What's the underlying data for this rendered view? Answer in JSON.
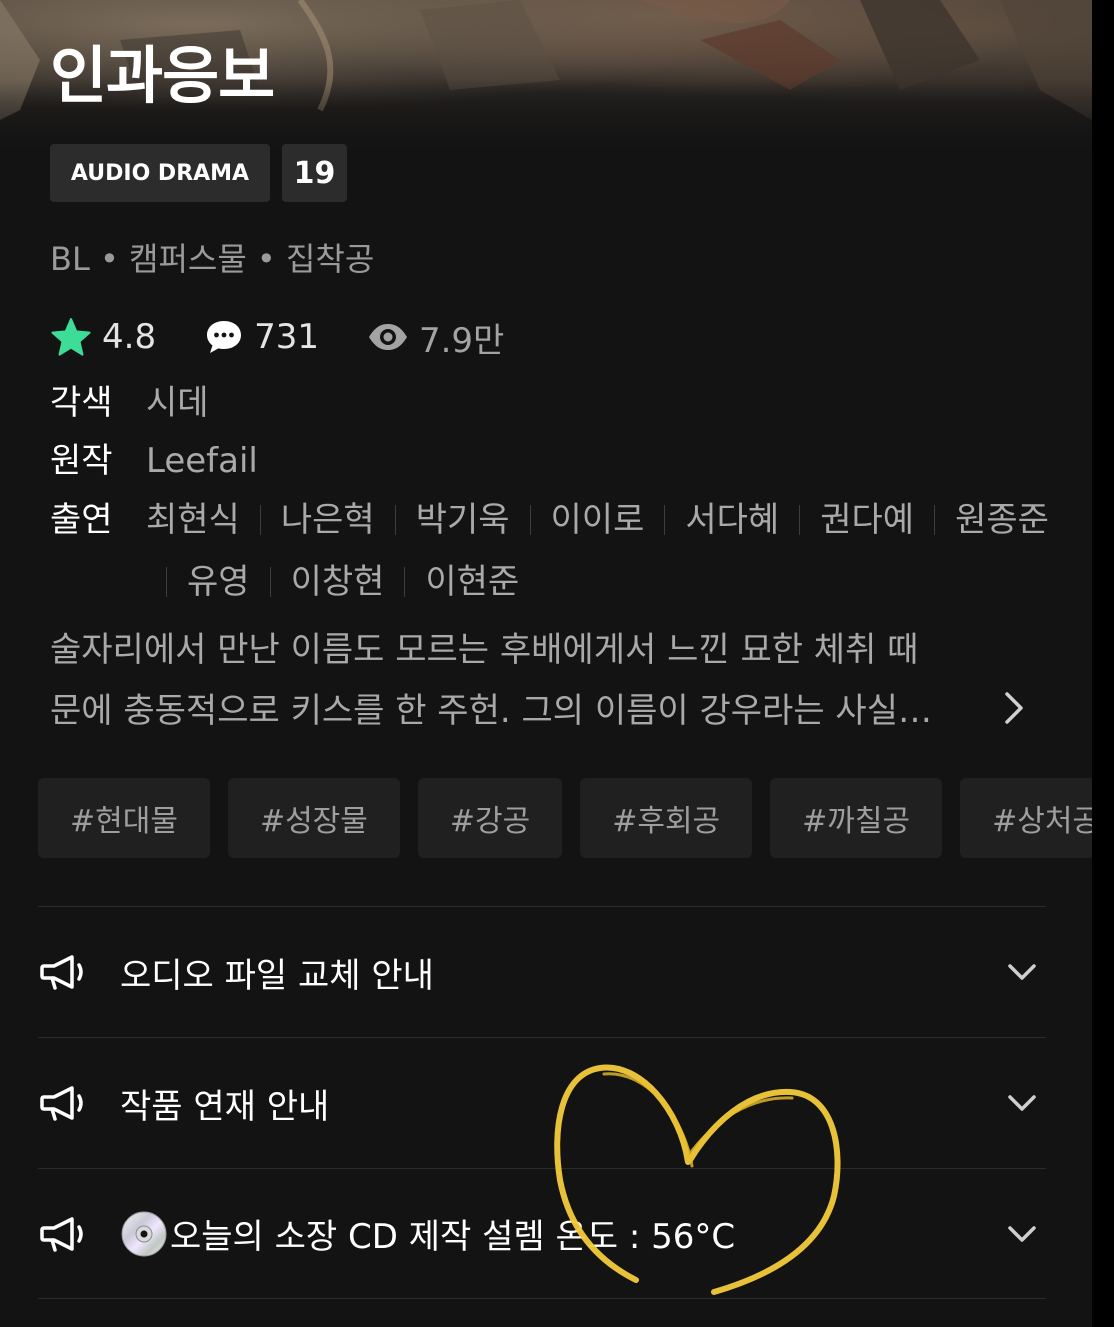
{
  "header": {
    "title": "인과응보",
    "badges": [
      "AUDIO DRAMA",
      "19"
    ]
  },
  "genres": "BL • 캠퍼스물 • 집착공",
  "stats": {
    "rating": "4.8",
    "comments": "731",
    "views": "7.9만"
  },
  "credits": {
    "adaptation_label": "각색",
    "adaptation": "시데",
    "original_label": "원작",
    "original": "Leefail",
    "cast_label": "출연",
    "cast": [
      "최현식",
      "나은혁",
      "박기욱",
      "이이로",
      "서다혜",
      "권다예",
      "원종준",
      "유영",
      "이창현",
      "이현준"
    ]
  },
  "synopsis": {
    "line1": "술자리에서 만난 이름도 모르는 후배에게서 느낀 묘한 체취 때",
    "line2": "문에 충동적으로 키스를 한 주헌. 그의 이름이 강우라는 사실…"
  },
  "tags": [
    "#현대물",
    "#성장물",
    "#강공",
    "#후회공",
    "#까칠공",
    "#상처공"
  ],
  "notices": [
    {
      "label": "오디오 파일 교체 안내"
    },
    {
      "label": "작품 연재 안내"
    },
    {
      "label": "오늘의 소장 CD 제작 설렘 온도 : 56°C"
    }
  ],
  "colors": {
    "background": "#131313",
    "star": "#3ddc97",
    "doodle": "#f2cb3a",
    "tag_bg": "#202020",
    "badge_bg": "#2c2c2c"
  },
  "icons": {
    "rating": "star-icon",
    "comments": "speech-bubble-icon",
    "views": "eye-icon",
    "notice": "megaphone-icon",
    "expand": "chevron-down-icon",
    "more": "chevron-right-icon",
    "cd": "disc-icon"
  }
}
